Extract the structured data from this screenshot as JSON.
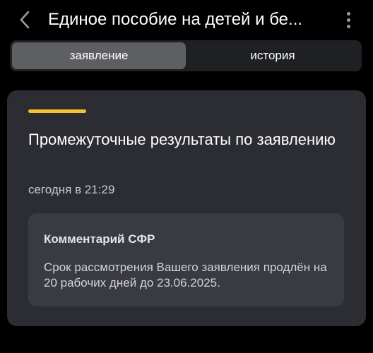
{
  "header": {
    "title": "Единое пособие на детей и бе...",
    "back_icon": "chevron-left-icon",
    "more_icon": "more-vertical-icon"
  },
  "tabs": [
    {
      "label": "заявление",
      "active": true
    },
    {
      "label": "история",
      "active": false
    }
  ],
  "card": {
    "accent_color": "#f2c230",
    "title": "Промежуточные результаты по заявлению",
    "time": "сегодня в 21:29",
    "comment": {
      "heading": "Комментарий СФР",
      "text": "Срок рассмотрения Вашего заявления продлён на 20 рабочих дней до 23.06.2025."
    }
  }
}
